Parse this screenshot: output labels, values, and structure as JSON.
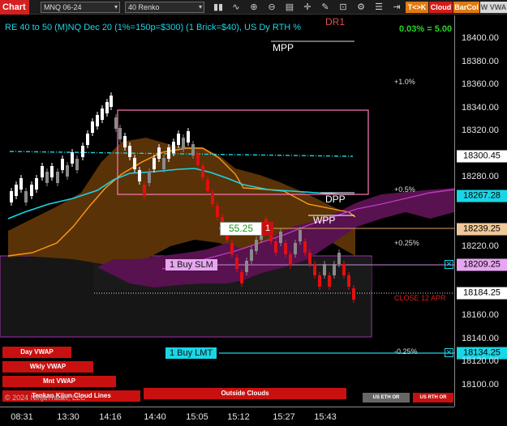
{
  "toolbar": {
    "chart_tab": "Chart",
    "instrument": "MNQ 06-24",
    "bar_type": "40 Renko",
    "tk_label": "T<>K",
    "cloud_label": "Cloud",
    "barcol_label": "BarCol",
    "vwap_label": "W VWA"
  },
  "title": "RE 40 to 50 (M)NQ Dec 20 (1%=150p=$300) (1 Brick=$40), US Dy RTH %",
  "pct_top": "0.03% = 5.00",
  "levels": {
    "dr1": "DR1",
    "mpp": "MPP",
    "dpp": "DPP",
    "wpp": "WPP"
  },
  "pct_labels": {
    "p1": "+1.0%",
    "p05": "+0.5%",
    "p025": "+0.25%",
    "m025": "-0.25%"
  },
  "close_label": "CLOSE 12 APR",
  "pnl_box": {
    "value": "55.25",
    "qty": "1"
  },
  "orders": {
    "slm": "1 Buy SLM",
    "lmt": "1 Buy LMT",
    "close_x": "✕"
  },
  "price_axis": {
    "ticks": [
      "18400.00",
      "18380.00",
      "18360.00",
      "18340.00",
      "18320.00",
      "18300.00",
      "18280.00",
      "18260.00",
      "18240.00",
      "18220.00",
      "18200.00",
      "18180.00",
      "18160.00",
      "18140.00",
      "18120.00",
      "18100.00"
    ],
    "badges": {
      "last": "18300.45",
      "dpp": "18267.28",
      "wpp": "18239.25",
      "slm": "18209.25",
      "close": "18184.25",
      "lmt": "18134.25"
    }
  },
  "time_axis": [
    "08:31",
    "13:30",
    "14:16",
    "14:40",
    "15:05",
    "15:12",
    "15:27",
    "15:43"
  ],
  "buttons": {
    "day_vwap": "Day VWAP",
    "wkly_vwap": "Wkly VWAP",
    "mnt_vwap": "Mnt VWAP",
    "tenkan_kijun": "Tenkan Kijun Cloud Lines",
    "outside_clouds": "Outside Clouds",
    "us_eth_or": "US ETH OR",
    "us_rth_or": "US RTH OR"
  },
  "copyright": "© 2024 NinjaTrader, LLC",
  "colors": {
    "accent_cyan": "#19d6e6",
    "up_brick": "#ffffff",
    "down_brick": "#e01010",
    "chart_tab": "#d32020",
    "cloud_purple": "#8a1f8a",
    "cloud_orange": "#8a4a0a"
  }
}
